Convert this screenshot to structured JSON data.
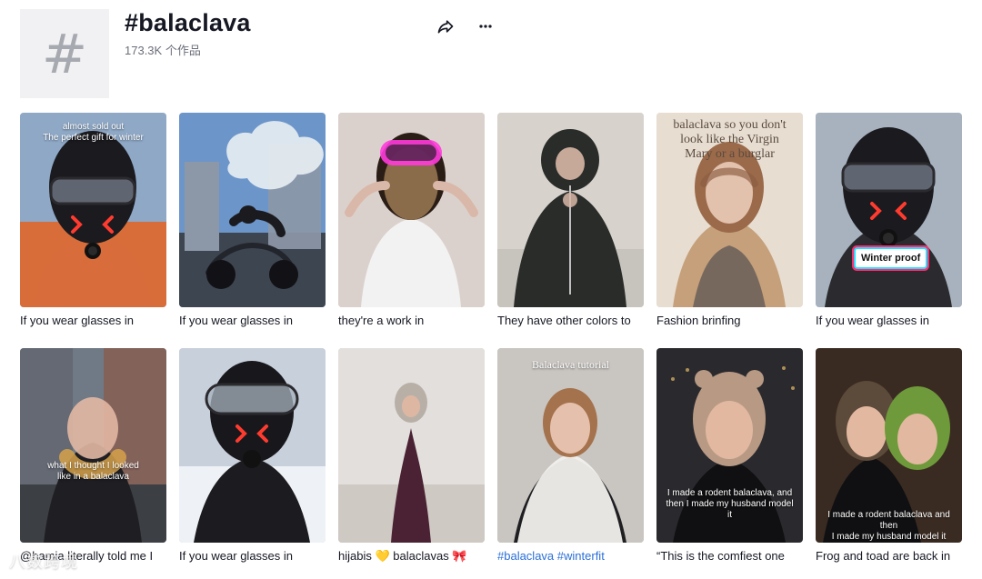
{
  "header": {
    "hash_glyph": "#",
    "title": "#balaclava",
    "subtitle": "173.3K 个作品",
    "share_icon": "share-icon",
    "more_icon": "more-icon"
  },
  "grid": {
    "items": [
      {
        "caption": "If you wear glasses in",
        "overlay": "almost sold out\nThe perfect gift for winter",
        "colors": {
          "bg": "#8ea8c6",
          "coat": "#d86d3a",
          "mask": "#1a1a1f",
          "accent": "#ff3b2f",
          "glass": "#9aa6b5"
        }
      },
      {
        "caption": "If you wear glasses in",
        "overlay": "",
        "colors": {
          "bg": "#6c95c9",
          "ground": "#3d4550",
          "building": "#8c97a8",
          "smoke": "#e9eef3",
          "bike": "#1b1b1f"
        }
      },
      {
        "caption": "they're a work in",
        "overlay": "",
        "colors": {
          "bg": "#c9c1bb",
          "wall": "#e9dfda",
          "hair": "#2a1d16",
          "mask": "#8a6b4a",
          "goggle": "#ff3bdc",
          "shirt": "#f2f2f2"
        }
      },
      {
        "caption": "They have other colors to",
        "overlay": "",
        "colors": {
          "bg": "#d7d2cc",
          "hoodie": "#2a2c2a",
          "floor": "#c7c3bd",
          "face": "#d8b7a6"
        }
      },
      {
        "caption": "Fashion brinfing",
        "overlay": "balaclava so you don't\nlook like the Virgin\nMary or a burglar",
        "colors": {
          "bg": "#e7ddd1",
          "hair": "#9a6a4a",
          "scarf": "#6e625b",
          "coat": "#c5a07a",
          "skin": "#e2c1ad"
        }
      },
      {
        "caption": "If you wear glasses in",
        "overlay": "",
        "badge": "Winter proof",
        "colors": {
          "bg": "#a7b2be",
          "mask": "#1a1a1f",
          "accent": "#ff3b2f",
          "glass": "#9aa6b5",
          "coat": "#2b2b2f"
        }
      },
      {
        "caption": "@hamia literally told me I",
        "overlay": "what I thought I looked\nlike in a balaclava",
        "colors": {
          "bg": "#6f7a86",
          "street": "#3c3f44",
          "building": "#8a5b4b",
          "scarf": "#d6a24a",
          "coat": "#1f1f23"
        }
      },
      {
        "caption": "If you wear glasses in",
        "overlay": "",
        "colors": {
          "bg": "#c8d0db",
          "snow": "#eef2f6",
          "mask": "#18181c",
          "accent": "#ff3b2f",
          "goggle": "#a7b2be"
        }
      },
      {
        "caption": "hijabis 💛 balaclavas 🎀",
        "overlay": "",
        "colors": {
          "bg": "#d7d3cf",
          "wall": "#ebe8e4",
          "coat": "#4a2233",
          "scarf": "#b8b0a7",
          "floor": "#cfc9c4"
        }
      },
      {
        "caption_parts": [
          {
            "text": "#balaclava",
            "class": "tag"
          },
          {
            "text": " ",
            "class": ""
          },
          {
            "text": "#winterfit",
            "class": "tag"
          }
        ],
        "overlay": "Balaclava tutorial",
        "colors": {
          "bg": "#b9b6b2",
          "wall": "#e9e3de",
          "scarf": "#f2f0ed",
          "hair": "#a0683f",
          "top": "#1f1f22"
        }
      },
      {
        "caption": "“This is the comfiest one",
        "overlay": "I made a rodent balaclava, and\nthen I made my husband model it",
        "colors": {
          "bg": "#2a2a2e",
          "knit": "#b89a84",
          "lights": "#f2c66b",
          "shirt": "#101012"
        }
      },
      {
        "caption": "Frog and toad are back in",
        "overlay": "I made a rodent balaclava and then\nI made my husband model it",
        "colors": {
          "bg": "#3a2b22",
          "knit_left": "#5c4a3a",
          "knit_right": "#6f9a3b",
          "skin": "#e3b8a1",
          "shirt": "#101012"
        }
      }
    ]
  },
  "watermark": {
    "text": "八数跨境"
  }
}
